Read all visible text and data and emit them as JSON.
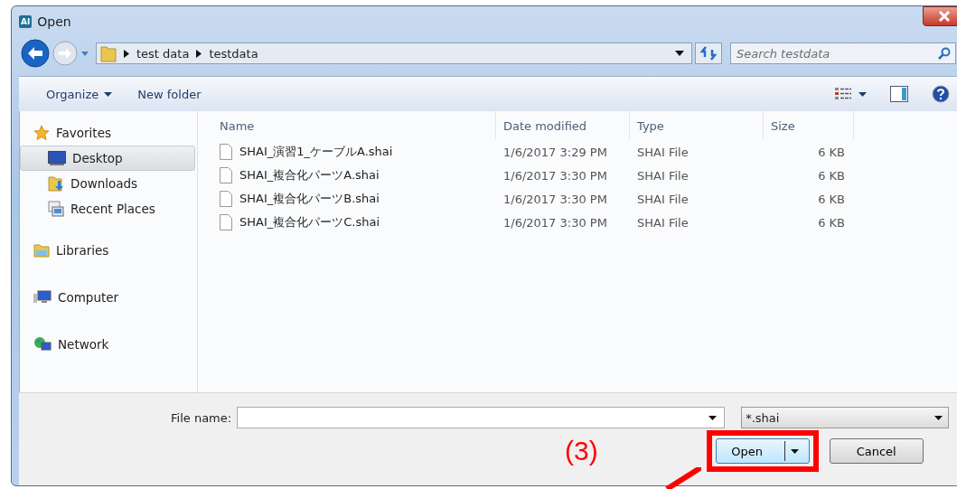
{
  "window": {
    "title": "Open",
    "app_badge": "AI"
  },
  "address": {
    "path": [
      "test data",
      "testdata"
    ],
    "search_placeholder": "Search testdata"
  },
  "toolbar": {
    "organize": "Organize",
    "new_folder": "New folder"
  },
  "sidebar": [
    {
      "label": "Favorites",
      "kind": "favorites",
      "selected": false,
      "children": [
        {
          "label": "Desktop",
          "kind": "desktop",
          "selected": true
        },
        {
          "label": "Downloads",
          "kind": "downloads",
          "selected": false
        },
        {
          "label": "Recent Places",
          "kind": "recent",
          "selected": false
        }
      ]
    },
    {
      "label": "Libraries",
      "kind": "libraries",
      "selected": false
    },
    {
      "label": "Computer",
      "kind": "computer",
      "selected": false
    },
    {
      "label": "Network",
      "kind": "network",
      "selected": false
    }
  ],
  "table": {
    "columns": [
      "Name",
      "Date modified",
      "Type",
      "Size"
    ],
    "rows": [
      [
        "SHAI_演習1_ケーブルA.shai",
        "1/6/2017 3:29 PM",
        "SHAI File",
        "6 KB"
      ],
      [
        "SHAI_複合化パーツA.shai",
        "1/6/2017 3:30 PM",
        "SHAI File",
        "6 KB"
      ],
      [
        "SHAI_複合化パーツB.shai",
        "1/6/2017 3:30 PM",
        "SHAI File",
        "6 KB"
      ],
      [
        "SHAI_複合化パーツC.shai",
        "1/6/2017 3:30 PM",
        "SHAI File",
        "6 KB"
      ]
    ]
  },
  "footer": {
    "file_name_label": "File name:",
    "filter": "*.shai",
    "open": "Open",
    "cancel": "Cancel"
  },
  "annotation": {
    "label": "(3)"
  }
}
